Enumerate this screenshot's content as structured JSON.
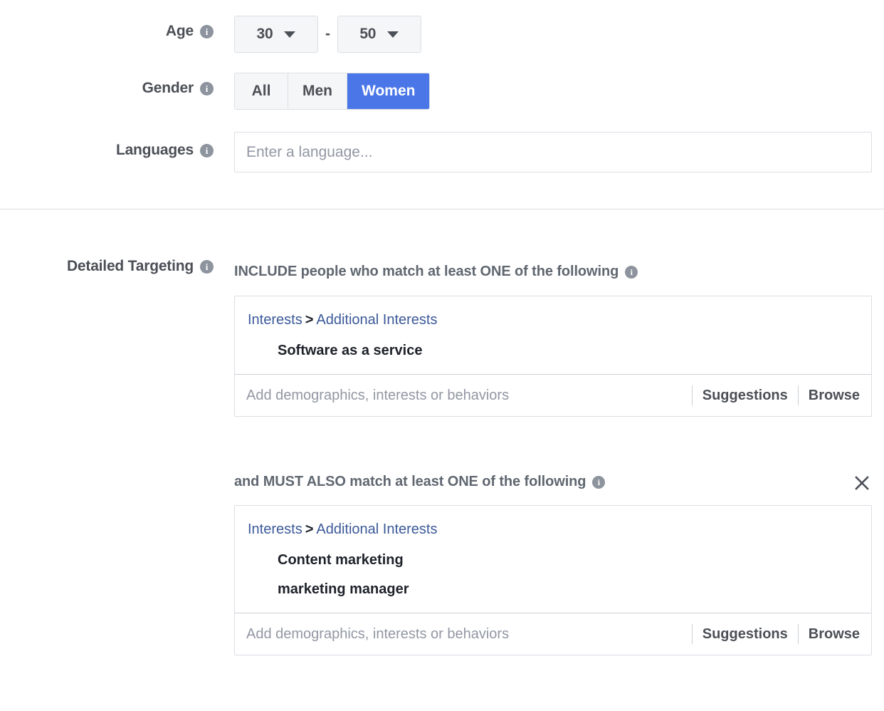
{
  "colors": {
    "accent_blue": "#4a76e8",
    "link_blue": "#3b5998",
    "label_gray": "#4b4f56",
    "placeholder_gray": "#9197a3",
    "border_gray": "#dcdee3"
  },
  "icons": {
    "info": "i",
    "caret_down": "caret-down-icon",
    "close": "close-icon"
  },
  "age": {
    "label": "Age",
    "min_value": "30",
    "max_value": "50",
    "separator": "-"
  },
  "gender": {
    "label": "Gender",
    "options": [
      {
        "label": "All",
        "selected": false
      },
      {
        "label": "Men",
        "selected": false
      },
      {
        "label": "Women",
        "selected": true
      }
    ]
  },
  "languages": {
    "label": "Languages",
    "value": "",
    "placeholder": "Enter a language..."
  },
  "detailed_targeting": {
    "label": "Detailed Targeting",
    "include_heading": "INCLUDE people who match at least ONE of the following",
    "narrow_heading": "and MUST ALSO match at least ONE of the following",
    "groups": [
      {
        "breadcrumb": {
          "root": "Interests",
          "separator": ">",
          "child": "Additional Interests"
        },
        "tags": [
          "Software as a service"
        ],
        "input_placeholder": "Add demographics, interests or behaviors",
        "suggestions_label": "Suggestions",
        "browse_label": "Browse"
      },
      {
        "breadcrumb": {
          "root": "Interests",
          "separator": ">",
          "child": "Additional Interests"
        },
        "tags": [
          "Content marketing",
          "marketing manager"
        ],
        "input_placeholder": "Add demographics, interests or behaviors",
        "suggestions_label": "Suggestions",
        "browse_label": "Browse"
      }
    ]
  }
}
